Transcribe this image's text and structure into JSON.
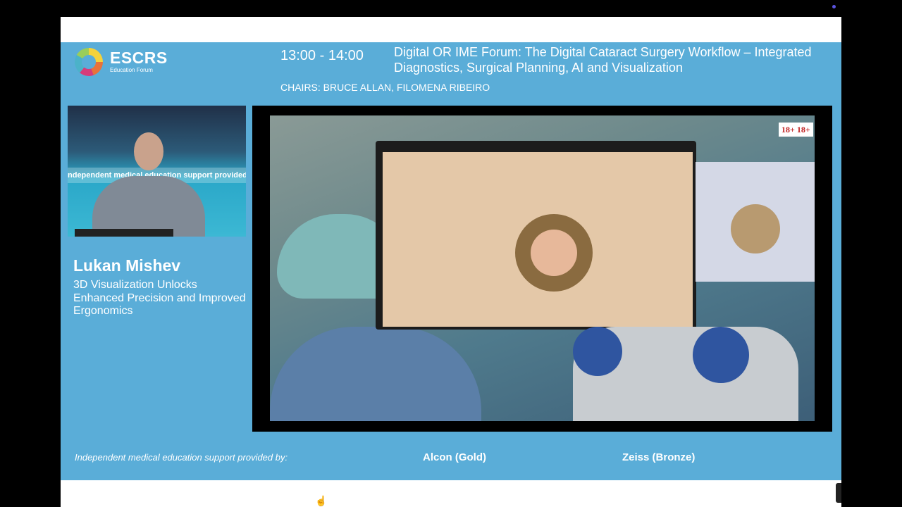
{
  "logo": {
    "name": "ESCRS",
    "subtitle": "Education Forum"
  },
  "session": {
    "time": "13:00 - 14:00",
    "title": "Digital OR IME Forum: The Digital Cataract Surgery Workflow – Integrated Diagnostics, Surgical Planning, AI and Visualization",
    "chairs": "CHAIRS: BRUCE ALLAN, FILOMENA RIBEIRO"
  },
  "speaker": {
    "name": "Lukan Mishev",
    "talk_title": "3D Visualization Unlocks Enhanced Precision and Improved Ergonomics",
    "video_banner_text": "ndependent medical education support provided by: A"
  },
  "main_video": {
    "badge": "18+ 18+"
  },
  "footer": {
    "support_label": "Independent medical education support provided by:",
    "sponsor_gold": "Alcon (Gold)",
    "sponsor_bronze": "Zeiss (Bronze)"
  },
  "colors": {
    "slide_bg": "#5aadd8",
    "text": "#ffffff",
    "frame": "#000000"
  },
  "icons": {
    "cursor": "hand-pointer-icon"
  }
}
